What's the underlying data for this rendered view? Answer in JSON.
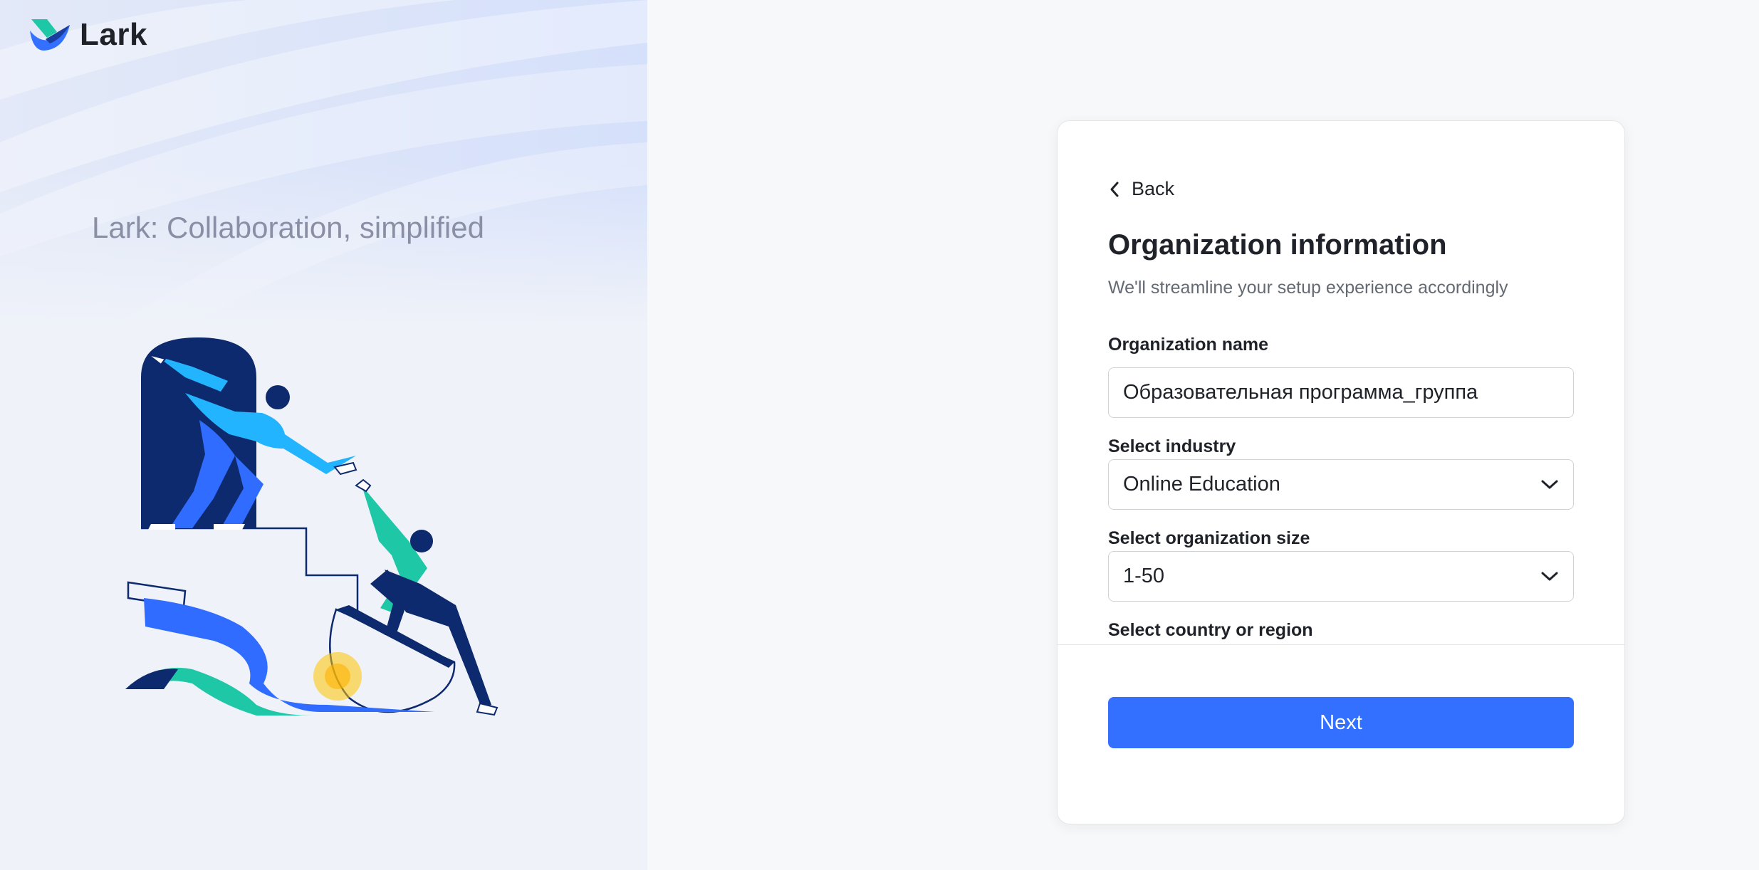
{
  "brand": {
    "name": "Lark",
    "accent": "#3370ff"
  },
  "hero": {
    "tagline": "Lark: Collaboration, simplified"
  },
  "form": {
    "back_label": "Back",
    "title": "Organization information",
    "subtitle": "We'll streamline your setup experience accordingly",
    "org_name_label": "Organization name",
    "org_name_value": "Образовательная программа_группа",
    "industry_label": "Select industry",
    "industry_value": "Online Education",
    "size_label": "Select organization size",
    "size_value": "1-50",
    "country_label": "Select country or region",
    "next_label": "Next"
  },
  "icons": {
    "back": "chevron-left-icon",
    "dropdown": "chevron-down-icon",
    "logo": "lark-logo"
  }
}
